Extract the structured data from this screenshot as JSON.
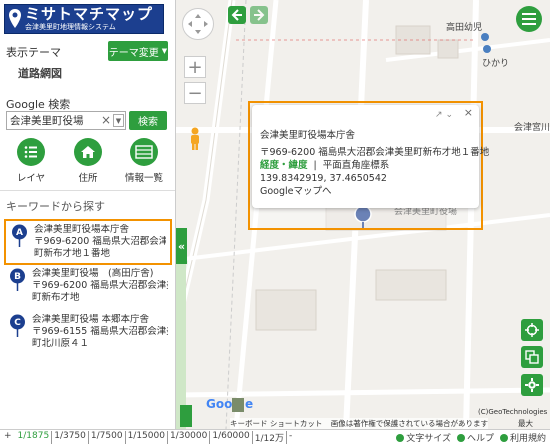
{
  "logo": {
    "title": "ミサトマチマップ",
    "subtitle": "会津美里町地理情報システム"
  },
  "theme": {
    "heading": "表示テーマ",
    "change_label": "テーマ変更",
    "name": "道路網図"
  },
  "search": {
    "heading": "Google 検索",
    "value": "会津美里町役場",
    "button_label": "検索"
  },
  "tools": [
    {
      "label": "レイヤ",
      "icon": "layers-icon"
    },
    {
      "label": "住所",
      "icon": "home-icon"
    },
    {
      "label": "情報一覧",
      "icon": "list-icon"
    }
  ],
  "keyword": {
    "heading": "キーワードから探す"
  },
  "results": [
    {
      "marker": "A",
      "line1": "会津美里町役場本庁舎",
      "line2": "〒969-6200 福島県大沼郡会津美里",
      "line3": "町新布才地１番地",
      "selected": true
    },
    {
      "marker": "B",
      "line1": "会津美里町役場　(高田庁舎)",
      "line2": "〒969-6200 福島県大沼郡会津美里",
      "line3": "町新布才地",
      "selected": false
    },
    {
      "marker": "C",
      "line1": "会津美里町役場 本郷本庁舎",
      "line2": "〒969-6155 福島県大沼郡会津美里",
      "line3": "町北川原４１",
      "selected": false
    }
  ],
  "popup": {
    "title": "会津美里町役場本庁舎",
    "address": "〒969-6200 福島県大沼郡会津美里町新布才地１番地",
    "coord_label": "経度・緯度",
    "coord_system": "平面直角座標系",
    "coords": "139.8342919, 37.4650542",
    "gmaps_link": "Googleマップへ"
  },
  "map_labels": {
    "school": "高田幼児",
    "hikari": "ひかり",
    "road": "会津宮川",
    "building": "会津美里町役場"
  },
  "attribution": {
    "google": "Google",
    "shortcuts": "キーボード ショートカット",
    "notice": "画像は著作権で保護されている場合があります",
    "copyright": "(C)GeoTechnologies Inc",
    "max": "最大"
  },
  "scales": [
    "1/1875",
    "1/3750",
    "1/7500",
    "1/15000",
    "1/30000",
    "1/60000",
    "1/12万",
    "-"
  ],
  "selected_scale": "1/1875",
  "footer_links": [
    "文字サイズ",
    "ヘルプ",
    "利用規約"
  ],
  "colors": {
    "green": "#2e9e3e",
    "highlight": "#f39200",
    "logo_bg": "#1c3f8f"
  }
}
